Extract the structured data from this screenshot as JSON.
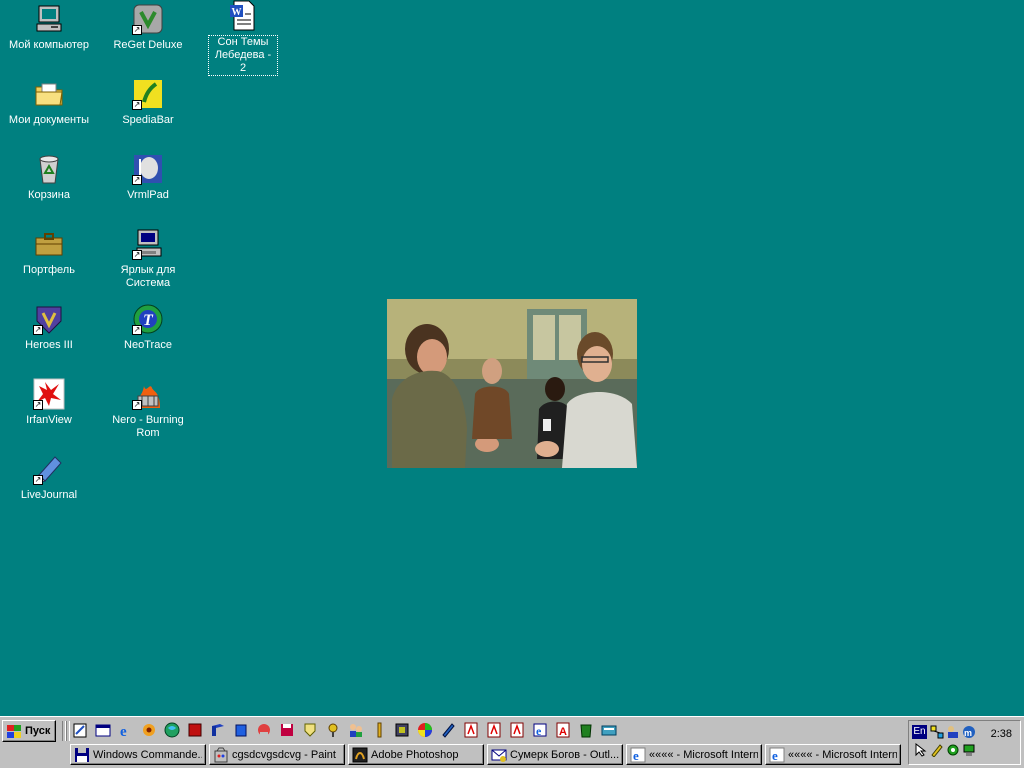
{
  "desktop": {
    "background_color": "#008080",
    "icons": [
      {
        "label": "Мой компьютер",
        "icon": "my-computer-icon"
      },
      {
        "label": "ReGet Deluxe",
        "icon": "reget-icon"
      },
      {
        "label": "Сон Темы Лебедева - 2",
        "icon": "word-document-icon"
      },
      {
        "label": "Мои документы",
        "icon": "folder-icon"
      },
      {
        "label": "SpediaBar",
        "icon": "spediabar-icon"
      },
      {
        "label": "Корзина",
        "icon": "recycle-bin-icon"
      },
      {
        "label": "VrmlPad",
        "icon": "vrmlpad-icon"
      },
      {
        "label": "Портфель",
        "icon": "briefcase-icon"
      },
      {
        "label": "Ярлык для Система",
        "icon": "system-shortcut-icon"
      },
      {
        "label": "Heroes III",
        "icon": "heroes-icon"
      },
      {
        "label": "NeoTrace",
        "icon": "neotrace-icon"
      },
      {
        "label": "IrfanView",
        "icon": "irfanview-icon"
      },
      {
        "label": "Nero - Burning Rom",
        "icon": "nero-icon"
      },
      {
        "label": "LiveJournal",
        "icon": "livejournal-pencil-icon"
      }
    ]
  },
  "taskbar": {
    "start_label": "Пуск",
    "tasks": [
      {
        "label": "Windows Commande...",
        "icon": "floppy-icon"
      },
      {
        "label": "cgsdcvgsdcvg - Paint",
        "icon": "paint-icon"
      },
      {
        "label": "Adobe Photoshop",
        "icon": "photoshop-icon"
      },
      {
        "label": "Сумерк Богов - Outl...",
        "icon": "outlook-icon"
      },
      {
        "label": "«««« - Microsoft Intern...",
        "icon": "ie-icon"
      },
      {
        "label": "«««« - Microsoft Intern...",
        "icon": "ie-icon"
      }
    ],
    "tray": {
      "language": "En",
      "clock": "2:38"
    }
  }
}
